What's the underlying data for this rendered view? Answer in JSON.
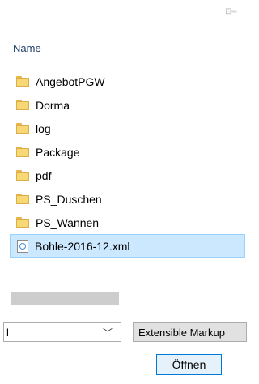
{
  "view_icon": "details-view-icon",
  "column_header": "Name",
  "files": [
    {
      "name": "AngebotPGW",
      "type": "folder"
    },
    {
      "name": "Dorma",
      "type": "folder"
    },
    {
      "name": "log",
      "type": "folder"
    },
    {
      "name": "Package",
      "type": "folder"
    },
    {
      "name": "pdf",
      "type": "folder"
    },
    {
      "name": "PS_Duschen",
      "type": "folder"
    },
    {
      "name": "PS_Wannen",
      "type": "folder"
    },
    {
      "name": "Bohle-2016-12.xml",
      "type": "xml",
      "selected": true
    }
  ],
  "filename_value": "l",
  "filetype_label": "Extensible Markup",
  "open_button": "Öffnen",
  "colors": {
    "selection": "#cce8ff",
    "accent": "#0078d7",
    "folder": "#f8d775"
  }
}
